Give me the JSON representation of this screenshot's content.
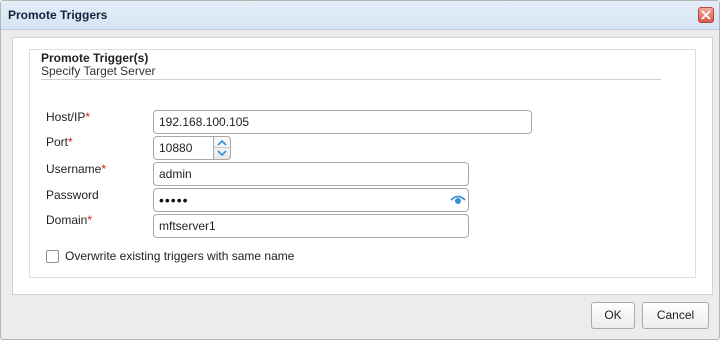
{
  "dialog": {
    "title": "Promote Triggers",
    "close_icon": "close-icon"
  },
  "section": {
    "title": "Promote Trigger(s)",
    "subtitle": "Specify Target Server"
  },
  "fields": {
    "host": {
      "label": "Host/IP",
      "required_mark": "*",
      "value": "192.168.100.105"
    },
    "port": {
      "label": "Port",
      "required_mark": "*",
      "value": "10880"
    },
    "username": {
      "label": "Username",
      "required_mark": "*",
      "value": "admin"
    },
    "password": {
      "label": "Password",
      "masked_value": "•••••",
      "reveal_icon": "eye-icon"
    },
    "domain": {
      "label": "Domain",
      "required_mark": "*",
      "value": "mftserver1"
    }
  },
  "overwrite": {
    "label": "Overwrite existing triggers with same name",
    "checked": false
  },
  "buttons": {
    "ok": "OK",
    "cancel": "Cancel"
  },
  "colors": {
    "required": "#d01b1b",
    "eye_icon": "#3a8fd1",
    "close_button": "#d9584b"
  }
}
